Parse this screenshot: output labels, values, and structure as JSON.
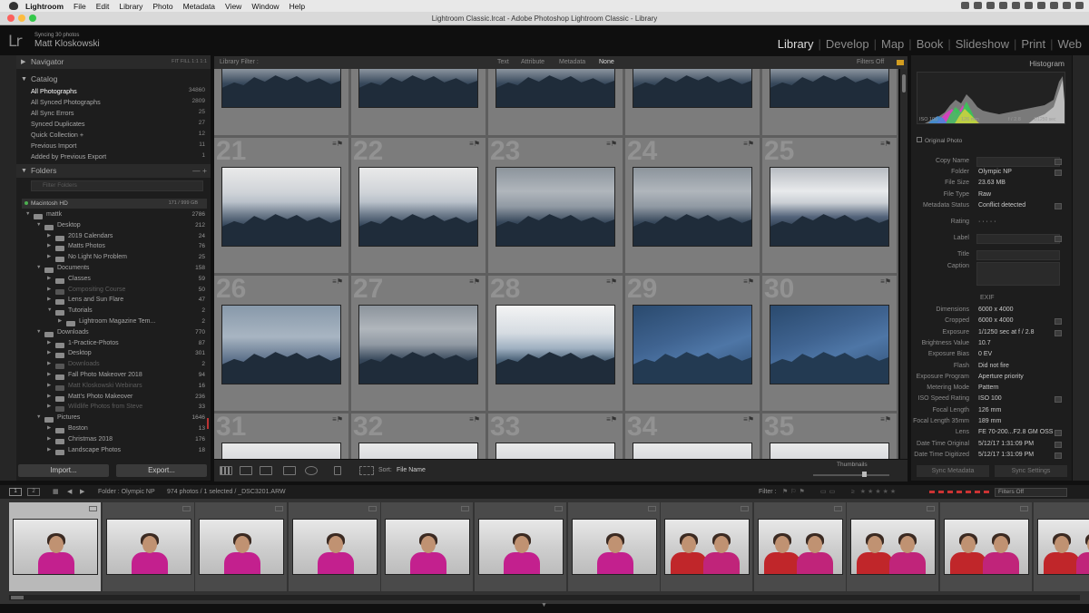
{
  "menubar": {
    "app": "Lightroom",
    "items": [
      "File",
      "Edit",
      "Library",
      "Photo",
      "Metadata",
      "View",
      "Window",
      "Help"
    ]
  },
  "window": {
    "title": "Lightroom Classic.lrcat - Adobe Photoshop Lightroom Classic - Library"
  },
  "identity": {
    "logo": "Lr",
    "status": "Syncing 30 photos",
    "user": "Matt Kloskowski"
  },
  "modules": [
    "Library",
    "Develop",
    "Map",
    "Book",
    "Slideshow",
    "Print",
    "Web"
  ],
  "left": {
    "navigator": {
      "title": "Navigator",
      "sizes": "FIT   FILL   1:1   1:1"
    },
    "catalog": {
      "title": "Catalog",
      "items": [
        {
          "label": "All Photographs",
          "count": "34860"
        },
        {
          "label": "All Synced Photographs",
          "count": "2809"
        },
        {
          "label": "All Sync Errors",
          "count": "25"
        },
        {
          "label": "Synced Duplicates",
          "count": "27"
        },
        {
          "label": "Quick Collection +",
          "count": "12"
        },
        {
          "label": "Previous Import",
          "count": "11"
        },
        {
          "label": "Added by Previous Export",
          "count": "1"
        }
      ]
    },
    "folders": {
      "title": "Folders",
      "filter_placeholder": "Filter Folders",
      "volume": {
        "name": "Macintosh HD",
        "space": "171 / 999 GB"
      },
      "rows": [
        {
          "label": "mattk",
          "count": "2786"
        },
        {
          "label": "Desktop",
          "count": "212"
        },
        {
          "label": "2019 Calendars",
          "count": "24"
        },
        {
          "label": "Matts Photos",
          "count": "76"
        },
        {
          "label": "No Light No Problem",
          "count": "25"
        },
        {
          "label": "Documents",
          "count": "158"
        },
        {
          "label": "Classes",
          "count": "59"
        },
        {
          "label": "Compositing Course",
          "count": "50"
        },
        {
          "label": "Lens and Sun Flare",
          "count": "47"
        },
        {
          "label": "Tutorials",
          "count": "2"
        },
        {
          "label": "Lightroom Magazine Tem...",
          "count": "2"
        },
        {
          "label": "Downloads",
          "count": "770"
        },
        {
          "label": "1-Practice-Photos",
          "count": "87"
        },
        {
          "label": "Desktop",
          "count": "301"
        },
        {
          "label": "Downloads",
          "count": "2"
        },
        {
          "label": "Fall Photo Makeover 2018",
          "count": "94"
        },
        {
          "label": "Matt Kloskowski Webinars",
          "count": "16"
        },
        {
          "label": "Matt's Photo Makeover",
          "count": "236"
        },
        {
          "label": "Wildlife Photos from Steve",
          "count": "33"
        },
        {
          "label": "Pictures",
          "count": "1646"
        },
        {
          "label": "Boston",
          "count": "13"
        },
        {
          "label": "Christmas 2018",
          "count": "176"
        },
        {
          "label": "Landscape Photos",
          "count": "18"
        }
      ]
    },
    "import_label": "Import...",
    "export_label": "Export..."
  },
  "filterbar": {
    "label": "Library Filter :",
    "options": [
      "Text",
      "Attribute",
      "Metadata",
      "None"
    ],
    "active": "None",
    "status": "Filters Off"
  },
  "grid": {
    "rows": [
      {
        "numbers": [
          "21",
          "22",
          "23",
          "24",
          "25"
        ]
      },
      {
        "numbers": [
          "26",
          "27",
          "28",
          "29",
          "30"
        ]
      },
      {
        "numbers": [
          "31",
          "32",
          "33",
          "34",
          "35"
        ]
      }
    ]
  },
  "toolbar": {
    "sort_label": "Sort:",
    "sort_value": "File Name",
    "thumbnails_label": "Thumbnails"
  },
  "right": {
    "histogram": {
      "title": "Histogram",
      "iso": "ISO 100",
      "focal": "126 mm",
      "aperture": "f / 2.8",
      "shutter": "1/1250 sec"
    },
    "original_photo": "Original Photo",
    "metadata": [
      {
        "key": "Copy Name",
        "value": ""
      },
      {
        "key": "Folder",
        "value": "Olympic NP"
      },
      {
        "key": "File Size",
        "value": "23.63 MB"
      },
      {
        "key": "File Type",
        "value": "Raw"
      },
      {
        "key": "Metadata Status",
        "value": "Conflict detected"
      },
      {
        "key": "Rating",
        "value": "· · · · ·"
      },
      {
        "key": "Label",
        "value": ""
      },
      {
        "key": "Title",
        "value": ""
      },
      {
        "key": "Caption",
        "value": ""
      }
    ],
    "exif_title": "EXIF",
    "exif": [
      {
        "key": "Dimensions",
        "value": "6000 x 4000"
      },
      {
        "key": "Cropped",
        "value": "6000 x 4000"
      },
      {
        "key": "Exposure",
        "value": "1/1250 sec at f / 2.8"
      },
      {
        "key": "Brightness Value",
        "value": "10.7"
      },
      {
        "key": "Exposure Bias",
        "value": "0 EV"
      },
      {
        "key": "Flash",
        "value": "Did not fire"
      },
      {
        "key": "Exposure Program",
        "value": "Aperture priority"
      },
      {
        "key": "Metering Mode",
        "value": "Pattern"
      },
      {
        "key": "ISO Speed Rating",
        "value": "ISO 100"
      },
      {
        "key": "Focal Length",
        "value": "126 mm"
      },
      {
        "key": "Focal Length 35mm",
        "value": "189 mm"
      },
      {
        "key": "Lens",
        "value": "FE 70-200...F2.8 GM OSS"
      },
      {
        "key": "Date Time Original",
        "value": "5/12/17 1:31:09 PM"
      },
      {
        "key": "Date Time Digitized",
        "value": "5/12/17 1:31:09 PM"
      }
    ],
    "sync_metadata": "Sync Metadata",
    "sync_settings": "Sync Settings"
  },
  "filmbar": {
    "screen1": "1",
    "screen2": "2",
    "source": "Folder : Olympic NP",
    "count": "974 photos / 1 selected / _DSC3201.ARW",
    "filter_label": "Filter :",
    "filter_status": "Filters Off"
  },
  "filmstrip": {
    "selected_index": 0,
    "count": 12
  }
}
